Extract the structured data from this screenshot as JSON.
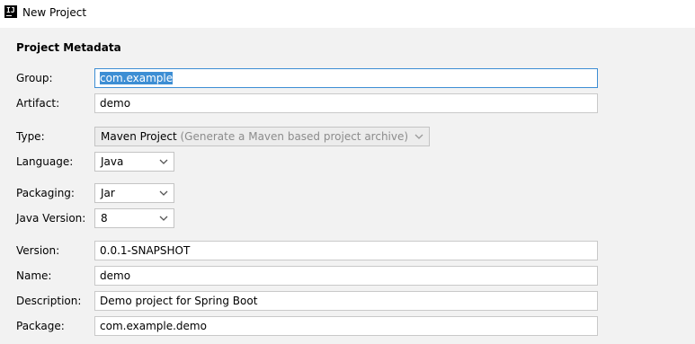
{
  "window": {
    "title": "New Project",
    "icon": "intellij-icon"
  },
  "section": {
    "title": "Project Metadata"
  },
  "fields": {
    "group": {
      "label": "Group:",
      "value": "com.example"
    },
    "artifact": {
      "label": "Artifact:",
      "value": "demo"
    },
    "type": {
      "label": "Type:",
      "value": "Maven Project",
      "hint": "(Generate a Maven based project archive)"
    },
    "language": {
      "label": "Language:",
      "value": "Java"
    },
    "packaging": {
      "label": "Packaging:",
      "value": "Jar"
    },
    "java_version": {
      "label": "Java Version:",
      "value": "8"
    },
    "version": {
      "label": "Version:",
      "value": "0.0.1-SNAPSHOT"
    },
    "name": {
      "label": "Name:",
      "value": "demo"
    },
    "description": {
      "label": "Description:",
      "value": "Demo project for Spring Boot"
    },
    "package": {
      "label": "Package:",
      "value": "com.example.demo"
    }
  },
  "colors": {
    "focus_accent": "#3d8ed4",
    "background": "#f2f2f2"
  }
}
